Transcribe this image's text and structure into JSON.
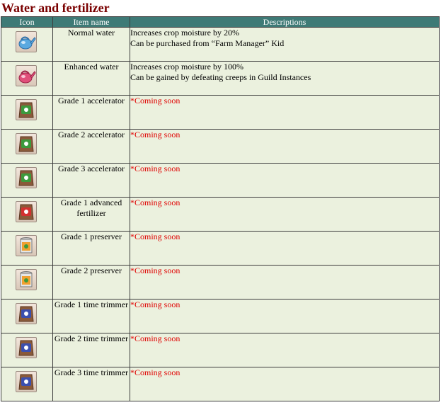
{
  "title": "Water and fertilizer",
  "headers": {
    "icon": "Icon",
    "item_name": "Item name",
    "descriptions": "Descriptions"
  },
  "colors": {
    "title": "#7a0000",
    "header_bg": "#3e7a76",
    "row_bg": "#ebf1de",
    "coming_soon": "#e00000"
  },
  "rows": [
    {
      "icon": "blue-watering-can-icon",
      "name": "Normal water",
      "desc": [
        "Increases crop moisture by 20%",
        "Can be purchased from “Farm Manager” Kid"
      ]
    },
    {
      "icon": "pink-watering-can-icon",
      "name": "Enhanced water",
      "desc": [
        "Increases crop moisture by 100%",
        "Can be gained by defeating creeps in Guild Instances"
      ]
    },
    {
      "icon": "green-fertilizer-bag-icon",
      "name": "Grade 1 accelerator",
      "soon": "*Coming soon"
    },
    {
      "icon": "green-fertilizer-bag-icon",
      "name": "Grade 2 accelerator",
      "soon": "*Coming soon"
    },
    {
      "icon": "green-fertilizer-bag-icon",
      "name": "Grade 3 accelerator",
      "soon": "*Coming soon"
    },
    {
      "icon": "red-fertilizer-bag-icon",
      "name": "Grade 1 advanced fertilizer",
      "soon": "*Coming soon"
    },
    {
      "icon": "preserver-can-icon",
      "name": "Grade 1 preserver",
      "soon": "*Coming soon"
    },
    {
      "icon": "preserver-can-icon",
      "name": "Grade 2 preserver",
      "soon": "*Coming soon"
    },
    {
      "icon": "blue-fertilizer-bag-icon",
      "name": "Grade 1 time trimmer",
      "soon": "*Coming soon"
    },
    {
      "icon": "blue-fertilizer-bag-icon",
      "name": "Grade 2 time trimmer",
      "soon": "*Coming soon"
    },
    {
      "icon": "blue-fertilizer-bag-icon",
      "name": "Grade 3 time trimmer",
      "soon": "*Coming soon"
    }
  ]
}
